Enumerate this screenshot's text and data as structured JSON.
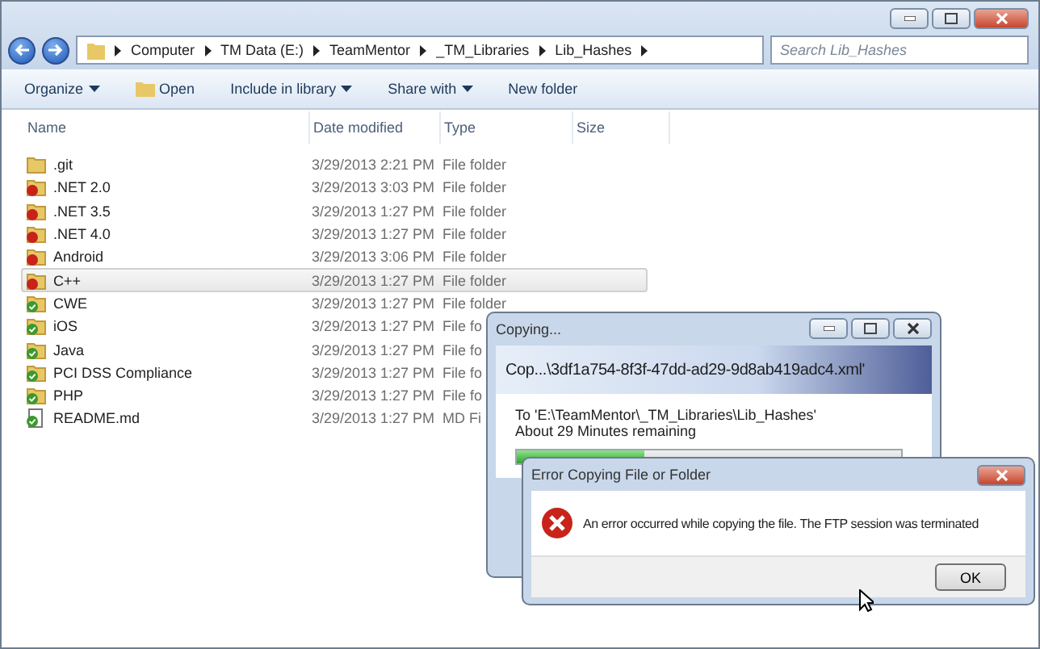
{
  "address_bar": {
    "segments": [
      "Computer",
      "TM Data (E:)",
      "TeamMentor",
      "_TM_Libraries",
      "Lib_Hashes"
    ]
  },
  "search": {
    "placeholder": "Search Lib_Hashes"
  },
  "toolbar": {
    "items": [
      {
        "label": "Organize",
        "dropdown": true,
        "kind": "menu"
      },
      {
        "label": "Open",
        "dropdown": false,
        "kind": "open"
      },
      {
        "label": "Include in library",
        "dropdown": true,
        "kind": "menu"
      },
      {
        "label": "Share with",
        "dropdown": true,
        "kind": "menu"
      },
      {
        "label": "New folder",
        "dropdown": false,
        "kind": "menu"
      }
    ]
  },
  "table": {
    "columns": [
      "Name",
      "Date modified",
      "Type",
      "Size"
    ],
    "rows": [
      {
        "name": ".git",
        "date": "3/29/2013 2:21 PM",
        "type": "File folder",
        "kind": "folder",
        "selected": false
      },
      {
        "name": ".NET 2.0",
        "date": "3/29/2013 3:03 PM",
        "type": "File folder",
        "kind": "folder-conflict",
        "selected": false
      },
      {
        "name": ".NET 3.5",
        "date": "3/29/2013 1:27 PM",
        "type": "File folder",
        "kind": "folder-conflict",
        "selected": false
      },
      {
        "name": ".NET 4.0",
        "date": "3/29/2013 1:27 PM",
        "type": "File folder",
        "kind": "folder-conflict",
        "selected": false
      },
      {
        "name": "Android",
        "date": "3/29/2013 3:06 PM",
        "type": "File folder",
        "kind": "folder-conflict",
        "selected": false
      },
      {
        "name": "C++",
        "date": "3/29/2013 1:27 PM",
        "type": "File folder",
        "kind": "folder-conflict",
        "selected": true
      },
      {
        "name": "CWE",
        "date": "3/29/2013 1:27 PM",
        "type": "File folder",
        "kind": "folder-synced",
        "selected": false
      },
      {
        "name": "iOS",
        "date": "3/29/2013 1:27 PM",
        "type": "File fo",
        "kind": "folder-synced",
        "selected": false
      },
      {
        "name": "Java",
        "date": "3/29/2013 1:27 PM",
        "type": "File fo",
        "kind": "folder-synced",
        "selected": false
      },
      {
        "name": "PCI DSS Compliance",
        "date": "3/29/2013 1:27 PM",
        "type": "File fo",
        "kind": "folder-synced",
        "selected": false
      },
      {
        "name": "PHP",
        "date": "3/29/2013 1:27 PM",
        "type": "File fo",
        "kind": "folder-synced",
        "selected": false
      },
      {
        "name": "README.md",
        "date": "3/29/2013 1:27 PM",
        "type": "MD Fi",
        "kind": "file-synced",
        "selected": false
      }
    ]
  },
  "copy_dialog": {
    "title": "Copying...",
    "file": "Cop...\\3df1a754-8f3f-47dd-ad29-9d8ab419adc4.xml'",
    "destination": "To 'E:\\TeamMentor\\_TM_Libraries\\Lib_Hashes'",
    "remaining": "About 29 Minutes remaining",
    "level": 0.33
  },
  "error_dialog": {
    "title": "Error Copying File or Folder",
    "message": "An error occurred while copying the file. The FTP session was terminated",
    "button": "OK"
  }
}
